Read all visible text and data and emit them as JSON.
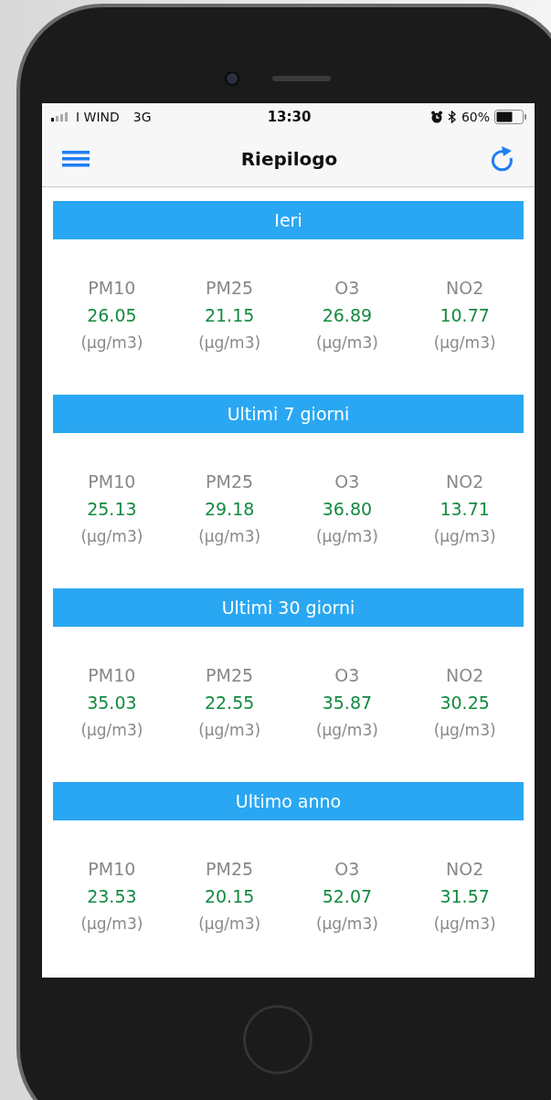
{
  "status_bar": {
    "carrier": "I WIND",
    "network": "3G",
    "time": "13:30",
    "battery": "60%"
  },
  "nav_bar": {
    "title": "Riepilogo"
  },
  "sections": [
    {
      "title": "Ieri",
      "metrics": [
        {
          "name": "PM10",
          "value": "26.05",
          "unit": "(µg/m3)"
        },
        {
          "name": "PM25",
          "value": "21.15",
          "unit": "(µg/m3)"
        },
        {
          "name": "O3",
          "value": "26.89",
          "unit": "(µg/m3)"
        },
        {
          "name": "NO2",
          "value": "10.77",
          "unit": "(µg/m3)"
        }
      ]
    },
    {
      "title": "Ultimi 7 giorni",
      "metrics": [
        {
          "name": "PM10",
          "value": "25.13",
          "unit": "(µg/m3)"
        },
        {
          "name": "PM25",
          "value": "29.18",
          "unit": "(µg/m3)"
        },
        {
          "name": "O3",
          "value": "36.80",
          "unit": "(µg/m3)"
        },
        {
          "name": "NO2",
          "value": "13.71",
          "unit": "(µg/m3)"
        }
      ]
    },
    {
      "title": "Ultimi 30 giorni",
      "metrics": [
        {
          "name": "PM10",
          "value": "35.03",
          "unit": "(µg/m3)"
        },
        {
          "name": "PM25",
          "value": "22.55",
          "unit": "(µg/m3)"
        },
        {
          "name": "O3",
          "value": "35.87",
          "unit": "(µg/m3)"
        },
        {
          "name": "NO2",
          "value": "30.25",
          "unit": "(µg/m3)"
        }
      ]
    },
    {
      "title": "Ultimo anno",
      "metrics": [
        {
          "name": "PM10",
          "value": "23.53",
          "unit": "(µg/m3)"
        },
        {
          "name": "PM25",
          "value": "20.15",
          "unit": "(µg/m3)"
        },
        {
          "name": "O3",
          "value": "52.07",
          "unit": "(µg/m3)"
        },
        {
          "name": "NO2",
          "value": "31.57",
          "unit": "(µg/m3)"
        }
      ]
    }
  ]
}
